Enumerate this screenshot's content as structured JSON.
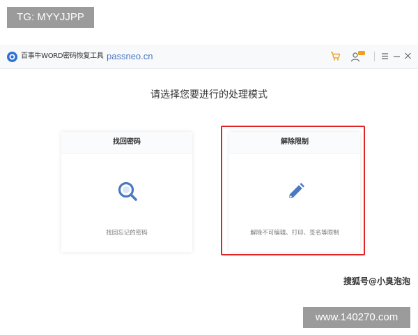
{
  "overlay": {
    "tg_label": "TG: MYYJJPP",
    "site_label": "www.140270.com",
    "sohu_watermark": "搜狐号@小臭泡泡"
  },
  "titlebar": {
    "app_name": "百事牛WORD密码恢复工具",
    "url": "passneo.cn",
    "icons": [
      "app-logo-icon",
      "cart-icon",
      "user-badge-icon",
      "menu-icon",
      "minimize-icon",
      "close-icon"
    ]
  },
  "main": {
    "prompt": "请选择您要进行的处理模式",
    "modes": [
      {
        "title": "找回密码",
        "description": "找回忘记的密码",
        "icon": "search-icon"
      },
      {
        "title": "解除限制",
        "description": "解除不可编辑、打印、签名等限制",
        "icon": "pencil-icon"
      }
    ]
  },
  "colors": {
    "accent": "#4a78c2",
    "highlight": "#e02424",
    "cart": "#f0a020",
    "label_bg": "#9b9b9b"
  }
}
